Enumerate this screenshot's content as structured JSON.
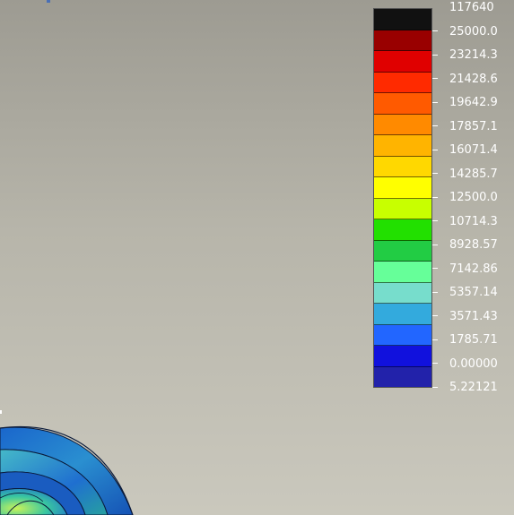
{
  "legend": {
    "labels": [
      "117640",
      "25000.0",
      "23214.3",
      "21428.6",
      "19642.9",
      "17857.1",
      "16071.4",
      "14285.7",
      "12500.0",
      "10714.3",
      "8928.57",
      "7142.86",
      "5357.14",
      "3571.43",
      "1785.71",
      "0.00000",
      "5.22121"
    ],
    "colors": [
      "#111111",
      "#990000",
      "#e00000",
      "#ff2a00",
      "#ff5a00",
      "#ff8a00",
      "#ffb400",
      "#ffd800",
      "#ffff00",
      "#c8ff00",
      "#22e000",
      "#22cc44",
      "#66ff99",
      "#77ddcc",
      "#33aadd",
      "#2266ff",
      "#1111dd",
      "#2222aa"
    ],
    "colors_note_free": true
  },
  "model": {
    "ring_colors": [
      "#2a5fb0",
      "#1f6fd0",
      "#47b8a8",
      "#1552b5",
      "#1a66cc"
    ],
    "highlight_colors": [
      "#b6f25a",
      "#39c7a0"
    ]
  }
}
